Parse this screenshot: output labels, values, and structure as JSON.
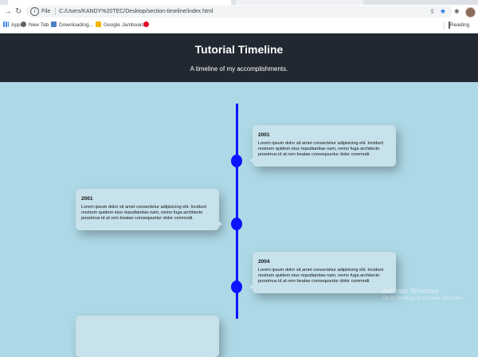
{
  "browser": {
    "address_prefix": "File",
    "url": "C:/Users/KANDY%20TEC/Desktop/section-timeline/index.html",
    "bookmarks": [
      "Apps",
      "New Tab",
      "Downloading...",
      "Google Jamboard"
    ],
    "reading_list": "Reading"
  },
  "header": {
    "title": "Tutorial Timeline",
    "subtitle": "A timeline of my accomplishments."
  },
  "timeline": {
    "entries": [
      {
        "year": "2001",
        "text": "Lorem ipsum dolor sit amet consectetur adipisicing elit. Incidunt nostrum quidem eius repudiandae nam, nemo fuga architecto possimus id at rem beatae consequuntur dolor commodi."
      },
      {
        "year": "2001",
        "text": "Lorem ipsum dolor sit amet consectetur adipisicing elit. Incidunt nostrum quidem eius repudiandae nam, nemo fuga architecto possimus id at rem beatae consequuntur dolor commodi."
      },
      {
        "year": "2004",
        "text": "Lorem ipsum dolor sit amet consectetur adipisicing elit. Incidunt nostrum quidem eius repudiandae nam, nemo fuga architecto possimus id at rem beatae consequuntur dolor commodi."
      }
    ]
  },
  "watermark": {
    "line1": "Activate Windows",
    "line2": "Go to Settings to activate Windows."
  },
  "colors": {
    "page_background": "#add8e6",
    "header_background": "#222831",
    "timeline_blue": "#0a14ff",
    "card_background": "#c7e2ea"
  }
}
